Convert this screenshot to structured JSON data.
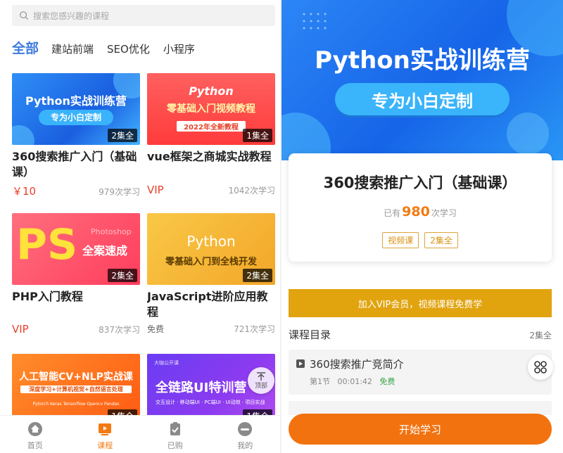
{
  "search": {
    "placeholder": "搜索您感兴趣的课程"
  },
  "tabs": [
    {
      "label": "全部",
      "active": true
    },
    {
      "label": "建站前端"
    },
    {
      "label": "SEO优化"
    },
    {
      "label": "小程序"
    }
  ],
  "courses": [
    {
      "thumb_line1": "Python实战训练营",
      "thumb_line2": "专为小白定制",
      "episodes": "2集全",
      "title": "360搜索推广入门（基础课）",
      "price": "￥10",
      "studied": "979次学习"
    },
    {
      "thumb_line1": "Python",
      "thumb_line2": "零基础入门视频教程",
      "thumb_line3": "2022年全新教程",
      "episodes": "1集全",
      "title": "vue框架之商城实战教程",
      "price": "VIP",
      "studied": "1042次学习"
    },
    {
      "thumb_line1": "PS",
      "thumb_line2": "全案速成",
      "thumb_line3": "Photoshop",
      "episodes": "2集全",
      "title": "PHP入门教程",
      "price": "VIP",
      "studied": "837次学习"
    },
    {
      "thumb_line1": "Python",
      "thumb_line2": "零基础入门到全栈开发",
      "episodes": "2集全",
      "title": "JavaScript进阶应用教程",
      "price": "免费",
      "studied": "721次学习"
    },
    {
      "thumb_line1": "人工智能CV+NLP实战课",
      "thumb_line2": "深度学习+计算机视觉+自然语言处理",
      "thumb_line3": "Pytorch  Keras  Tensorflow  Opencv  Pandas",
      "episodes": "1集全"
    },
    {
      "thumb_line1": "大咖公开课",
      "thumb_line2": "全链路UI特训营",
      "thumb_line3": "交互设计 · 移动端UI · PC端UI · UI动效 · 项目实战",
      "episodes": "1集全"
    }
  ],
  "back_to_top": "顶部",
  "bottom_nav": [
    {
      "label": "首页",
      "icon": "home-icon"
    },
    {
      "label": "课程",
      "icon": "course-icon",
      "active": true
    },
    {
      "label": "已购",
      "icon": "purchased-icon"
    },
    {
      "label": "我的",
      "icon": "profile-icon"
    }
  ],
  "detail": {
    "hero_line1": "Python实战训练营",
    "hero_line2": "专为小白定制",
    "title": "360搜索推广入门（基础课）",
    "stats_prefix": "已有",
    "stats_count": "980",
    "stats_suffix": "次学习",
    "tags": [
      "视频课",
      "2集全"
    ],
    "vip_banner": "加入VIP会员，视频课程免费学",
    "catalog_title": "课程目录",
    "catalog_count": "2集全",
    "lessons": [
      {
        "title": "360搜索推广竞简介",
        "section": "第1节",
        "duration": "00:01:42",
        "price": "免费"
      }
    ],
    "start_button": "开始学习"
  },
  "colors": {
    "accent_blue": "#3d7bdf",
    "accent_orange": "#f37a12",
    "vip_gold": "#e1a30e",
    "price_red": "#e8412a"
  }
}
